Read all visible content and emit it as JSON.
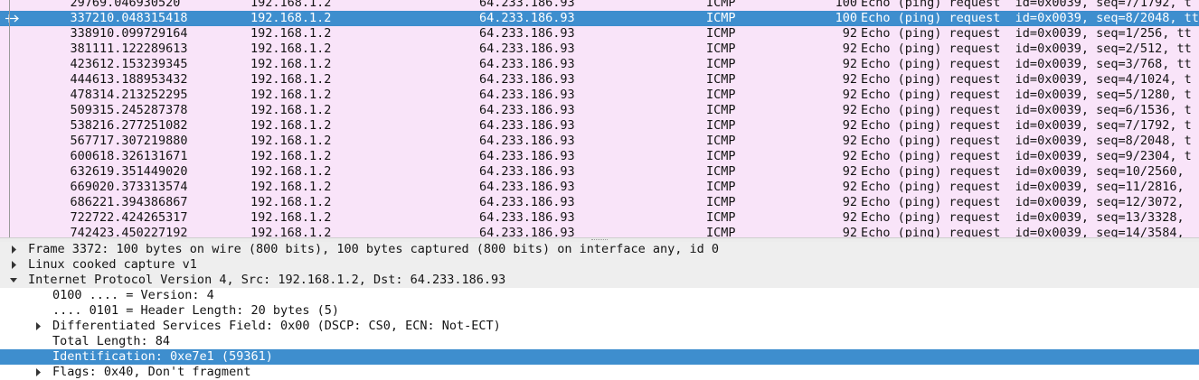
{
  "colors": {
    "row_bg": "#f9e4f9",
    "selected_bg": "#3e8ece",
    "section_bg": "#eeeeee"
  },
  "packet_list": {
    "rows": [
      {
        "no": "2976",
        "time": "9.046930520",
        "src": "192.168.1.2",
        "dst": "64.233.186.93",
        "proto": "ICMP",
        "len": "100",
        "info": "Echo (ping) request  id=0x0039, seq=7/1792, t"
      },
      {
        "no": "3372",
        "time": "10.048315418",
        "src": "192.168.1.2",
        "dst": "64.233.186.93",
        "proto": "ICMP",
        "len": "100",
        "info": "Echo (ping) request  id=0x0039, seq=8/2048, tt",
        "selected": true
      },
      {
        "no": "3389",
        "time": "10.099729164",
        "src": "192.168.1.2",
        "dst": "64.233.186.93",
        "proto": "ICMP",
        "len": "92",
        "info": "Echo (ping) request  id=0x0039, seq=1/256, tt"
      },
      {
        "no": "3811",
        "time": "11.122289613",
        "src": "192.168.1.2",
        "dst": "64.233.186.93",
        "proto": "ICMP",
        "len": "92",
        "info": "Echo (ping) request  id=0x0039, seq=2/512, tt"
      },
      {
        "no": "4236",
        "time": "12.153239345",
        "src": "192.168.1.2",
        "dst": "64.233.186.93",
        "proto": "ICMP",
        "len": "92",
        "info": "Echo (ping) request  id=0x0039, seq=3/768, tt"
      },
      {
        "no": "4446",
        "time": "13.188953432",
        "src": "192.168.1.2",
        "dst": "64.233.186.93",
        "proto": "ICMP",
        "len": "92",
        "info": "Echo (ping) request  id=0x0039, seq=4/1024, t"
      },
      {
        "no": "4783",
        "time": "14.213252295",
        "src": "192.168.1.2",
        "dst": "64.233.186.93",
        "proto": "ICMP",
        "len": "92",
        "info": "Echo (ping) request  id=0x0039, seq=5/1280, t"
      },
      {
        "no": "5093",
        "time": "15.245287378",
        "src": "192.168.1.2",
        "dst": "64.233.186.93",
        "proto": "ICMP",
        "len": "92",
        "info": "Echo (ping) request  id=0x0039, seq=6/1536, t"
      },
      {
        "no": "5382",
        "time": "16.277251082",
        "src": "192.168.1.2",
        "dst": "64.233.186.93",
        "proto": "ICMP",
        "len": "92",
        "info": "Echo (ping) request  id=0x0039, seq=7/1792, t"
      },
      {
        "no": "5677",
        "time": "17.307219880",
        "src": "192.168.1.2",
        "dst": "64.233.186.93",
        "proto": "ICMP",
        "len": "92",
        "info": "Echo (ping) request  id=0x0039, seq=8/2048, t"
      },
      {
        "no": "6006",
        "time": "18.326131671",
        "src": "192.168.1.2",
        "dst": "64.233.186.93",
        "proto": "ICMP",
        "len": "92",
        "info": "Echo (ping) request  id=0x0039, seq=9/2304, t"
      },
      {
        "no": "6326",
        "time": "19.351449020",
        "src": "192.168.1.2",
        "dst": "64.233.186.93",
        "proto": "ICMP",
        "len": "92",
        "info": "Echo (ping) request  id=0x0039, seq=10/2560,"
      },
      {
        "no": "6690",
        "time": "20.373313574",
        "src": "192.168.1.2",
        "dst": "64.233.186.93",
        "proto": "ICMP",
        "len": "92",
        "info": "Echo (ping) request  id=0x0039, seq=11/2816,"
      },
      {
        "no": "6862",
        "time": "21.394386867",
        "src": "192.168.1.2",
        "dst": "64.233.186.93",
        "proto": "ICMP",
        "len": "92",
        "info": "Echo (ping) request  id=0x0039, seq=12/3072,"
      },
      {
        "no": "7227",
        "time": "22.424265317",
        "src": "192.168.1.2",
        "dst": "64.233.186.93",
        "proto": "ICMP",
        "len": "92",
        "info": "Echo (ping) request  id=0x0039, seq=13/3328,"
      },
      {
        "no": "7424",
        "time": "23.450227192",
        "src": "192.168.1.2",
        "dst": "64.233.186.93",
        "proto": "ICMP",
        "len": "92",
        "info": "Echo (ping) request  id=0x0039, seq=14/3584,"
      }
    ]
  },
  "detail_tree": {
    "rows": [
      {
        "text": "Frame 3372: 100 bytes on wire (800 bits), 100 bytes captured (800 bits) on interface any, id 0",
        "state": "collapsed",
        "level": 0
      },
      {
        "text": "Linux cooked capture v1",
        "state": "collapsed",
        "level": 0
      },
      {
        "text": "Internet Protocol Version 4, Src: 192.168.1.2, Dst: 64.233.186.93",
        "state": "expanded",
        "level": 0
      },
      {
        "text": "0100 .... = Version: 4",
        "state": "leaf",
        "level": 1
      },
      {
        "text": ".... 0101 = Header Length: 20 bytes (5)",
        "state": "leaf",
        "level": 1
      },
      {
        "text": "Differentiated Services Field: 0x00 (DSCP: CS0, ECN: Not-ECT)",
        "state": "collapsed",
        "level": 1
      },
      {
        "text": "Total Length: 84",
        "state": "leaf",
        "level": 1
      },
      {
        "text": "Identification: 0xe7e1 (59361)",
        "state": "leaf",
        "level": 1,
        "selected": true
      },
      {
        "text": "Flags: 0x40, Don't fragment",
        "state": "collapsed",
        "level": 1
      }
    ]
  }
}
